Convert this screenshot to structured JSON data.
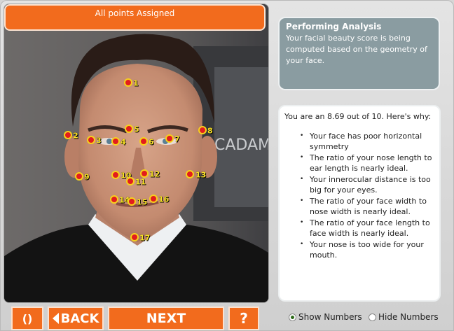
{
  "status": {
    "text": "All points Assigned"
  },
  "analysis": {
    "title": "Performing Analysis",
    "text": "Your facial beauty score is being computed based on the geometry of your face."
  },
  "result": {
    "summary": "You are an 8.69 out of 10.  Here's why:",
    "reasons": [
      "Your face has poor horizontal symmetry",
      "The ratio of your nose length to ear length is nearly ideal.",
      "Your innerocular distance is too big for your eyes.",
      "The ratio of your face width to nose width is nearly ideal.",
      "The ratio of your face length to face width is nearly ideal.",
      "Your nose is too wide for your mouth."
    ]
  },
  "photo": {
    "background_text": "CADAM"
  },
  "face_points": [
    "1",
    "2",
    "3",
    "4",
    "5",
    "6",
    "7",
    "8",
    "9",
    "10",
    "11",
    "12",
    "13",
    "14",
    "15",
    "16",
    "17"
  ],
  "toolbar": {
    "reset_label": "()",
    "back_label": "BACK",
    "next_label": "NEXT",
    "help_label": "?"
  },
  "display_options": {
    "show_numbers_label": "Show Numbers",
    "hide_numbers_label": "Hide Numbers",
    "selected": "Show Numbers"
  },
  "colors": {
    "accent": "#f26b1d",
    "panel": "#8a9ca1",
    "point_fill": "#e21d1d",
    "point_ring": "#f7d21b",
    "label": "#f8e025"
  }
}
